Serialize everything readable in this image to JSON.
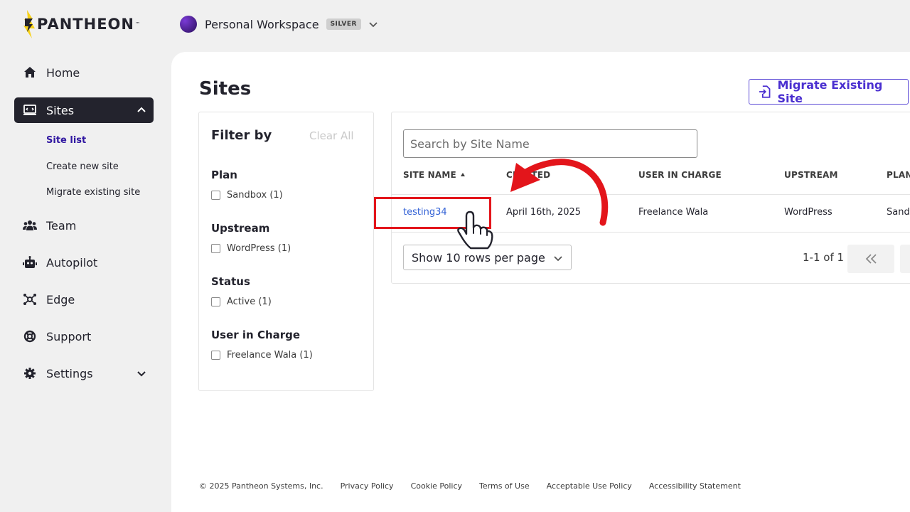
{
  "brand": {
    "name": "PANTHEON",
    "trademark": "™"
  },
  "workspace": {
    "name": "Personal Workspace",
    "badge": "SILVER"
  },
  "sidebar": {
    "items": [
      {
        "label": "Home",
        "icon": "home-icon"
      },
      {
        "label": "Sites",
        "icon": "monitor-icon"
      },
      {
        "label": "Team",
        "icon": "team-icon"
      },
      {
        "label": "Autopilot",
        "icon": "robot-icon"
      },
      {
        "label": "Edge",
        "icon": "network-icon"
      },
      {
        "label": "Support",
        "icon": "lifebuoy-icon"
      },
      {
        "label": "Settings",
        "icon": "gear-icon"
      }
    ],
    "sites_sub": [
      "Site list",
      "Create new site",
      "Migrate existing site"
    ]
  },
  "page": {
    "title": "Sites",
    "migrate_button": "Migrate Existing Site"
  },
  "filter": {
    "title": "Filter by",
    "clear": "Clear All",
    "groups": [
      {
        "title": "Plan",
        "option": "Sandbox (1)"
      },
      {
        "title": "Upstream",
        "option": "WordPress (1)"
      },
      {
        "title": "Status",
        "option": "Active (1)"
      },
      {
        "title": "User in Charge",
        "option": "Freelance Wala (1)"
      }
    ]
  },
  "table": {
    "search_placeholder": "Search by Site Name",
    "columns": [
      "SITE NAME",
      "CREATED",
      "USER IN CHARGE",
      "UPSTREAM",
      "PLAN"
    ],
    "rows": [
      [
        "testing34",
        "April 16th, 2025",
        "Freelance Wala",
        "WordPress",
        "Sandbox"
      ]
    ],
    "rows_per_page": "Show 10 rows per page",
    "pagination": "1-1 of 1"
  },
  "footer": {
    "copyright": "© 2025 Pantheon Systems, Inc.",
    "links": [
      "Privacy Policy",
      "Cookie Policy",
      "Terms of Use",
      "Acceptable Use Policy",
      "Accessibility Statement"
    ]
  },
  "colors": {
    "accent": "#4a2fd0",
    "link": "#3362d6",
    "annotation": "#e3151b",
    "sidebar_active": "#23232d"
  }
}
